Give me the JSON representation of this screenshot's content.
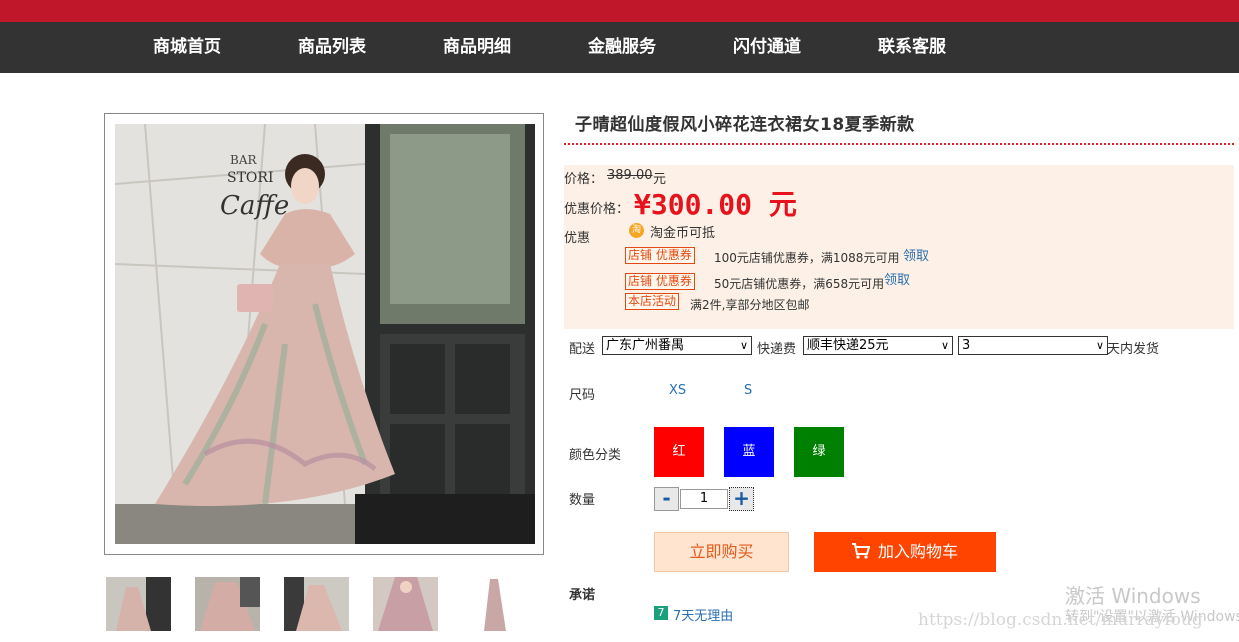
{
  "nav": {
    "items": [
      "商城首页",
      "商品列表",
      "商品明细",
      "金融服务",
      "闪付通道",
      "联系客服"
    ]
  },
  "product": {
    "title": "子晴超仙度假风小碎花连衣裙女18夏季新款",
    "price_label": "价格：",
    "original_price": "389.00",
    "price_unit": "元",
    "promo_label": "优惠价格：",
    "promo_price": "¥300.00 元",
    "discount_label": "优惠",
    "coin_icon_text": "淘",
    "coin_text": "淘金币可抵",
    "coupons": [
      {
        "tag": "店铺 优惠券",
        "text": "100元店铺优惠券，满1088元可用",
        "link": "领取"
      },
      {
        "tag": "店铺 优惠券",
        "text": "50元店铺优惠券，满658元可用",
        "link": "领取"
      }
    ],
    "activity": {
      "tag": "本店活动",
      "text": "满2件,享部分地区包邮"
    }
  },
  "shipping": {
    "label": "配送",
    "region": "广东广州番禺",
    "fee_label": "快递费",
    "fee": "顺丰快递25元",
    "days": "3",
    "days_suffix": "天内发货"
  },
  "size": {
    "label": "尺码",
    "options": [
      "XS",
      "S"
    ]
  },
  "color": {
    "label": "颜色分类",
    "options": [
      {
        "label": "红",
        "color": "#ff0000"
      },
      {
        "label": "蓝",
        "color": "#0000ff"
      },
      {
        "label": "绿",
        "color": "#008000"
      }
    ]
  },
  "quantity": {
    "label": "数量",
    "minus": "-",
    "value": "1",
    "plus": "+"
  },
  "actions": {
    "buy_now": "立即购买",
    "add_to_cart": "加入购物车"
  },
  "promise": {
    "label": "承诺",
    "badge": "7",
    "text": "7天无理由"
  },
  "watermark": {
    "activate_title": "激活 Windows",
    "activate_sub": "转到\"设置\"以激活 Windows。",
    "blog_url": "https://blog.csdn.net/murrayfoug"
  },
  "theme": {
    "topbar": "#c0182a",
    "nav_bg": "#333333",
    "price_red": "#e8121c",
    "cart_orange": "#ff4400",
    "link_blue": "#2a6fb0"
  }
}
